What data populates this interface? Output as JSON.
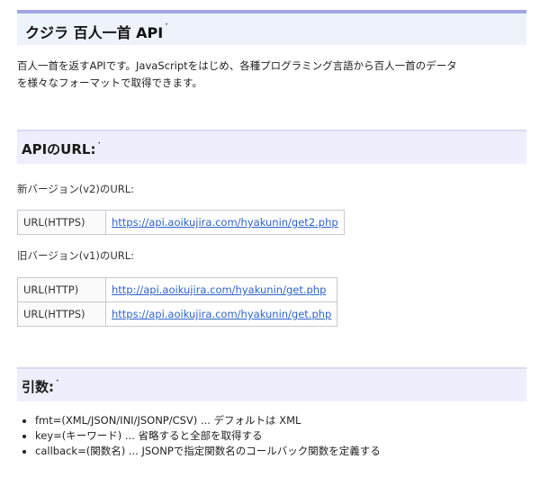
{
  "header": {
    "title": "クジラ 百人一首 API",
    "anchor_mark": "·"
  },
  "intro": {
    "line1": "百人一首を返すAPIです。JavaScriptをはじめ、各種プログラミング言語から百人一首のデータ",
    "line2": "を様々なフォーマットで取得できます。"
  },
  "api_url_section": {
    "heading": "APIのURL:",
    "anchor_mark": "·",
    "v2_label": "新バージョン(v2)のURL:",
    "v2_rows": [
      {
        "key": "URL(HTTPS)",
        "url": "https://api.aoikujira.com/hyakunin/get2.php"
      }
    ],
    "v1_label": "旧バージョン(v1)のURL:",
    "v1_rows": [
      {
        "key": "URL(HTTP)",
        "url": "http://api.aoikujira.com/hyakunin/get.php"
      },
      {
        "key": "URL(HTTPS)",
        "url": "https://api.aoikujira.com/hyakunin/get.php"
      }
    ]
  },
  "args_section": {
    "heading": "引数:",
    "anchor_mark": "·",
    "items": [
      "fmt=(XML/JSON/INI/JSONP/CSV) ... デフォルトは XML",
      "key=(キーワード) ... 省略すると全部を取得する",
      "callback=(関数名) ... JSONPで指定関数名のコールバック関数を定義する"
    ]
  },
  "colors": {
    "link": "#2e63c9",
    "header_border": "#a3a6e6",
    "header_bg": "#eef3fb",
    "section_bg": "#eeeefc"
  }
}
